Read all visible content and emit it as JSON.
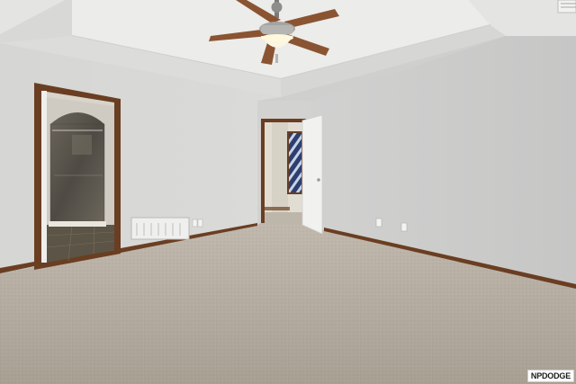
{
  "scene": {
    "description_visible_text_only": true,
    "watermark": "NPDODGE"
  },
  "colors": {
    "wall_left": "#d9d9d7",
    "wall_right": "#cdcdcc",
    "ceiling": "#e6e6e4",
    "carpet": "#b0a89c",
    "trim_wood": "#6a3e22",
    "door": "#f1f1ef",
    "tile": "#5e5a52"
  }
}
